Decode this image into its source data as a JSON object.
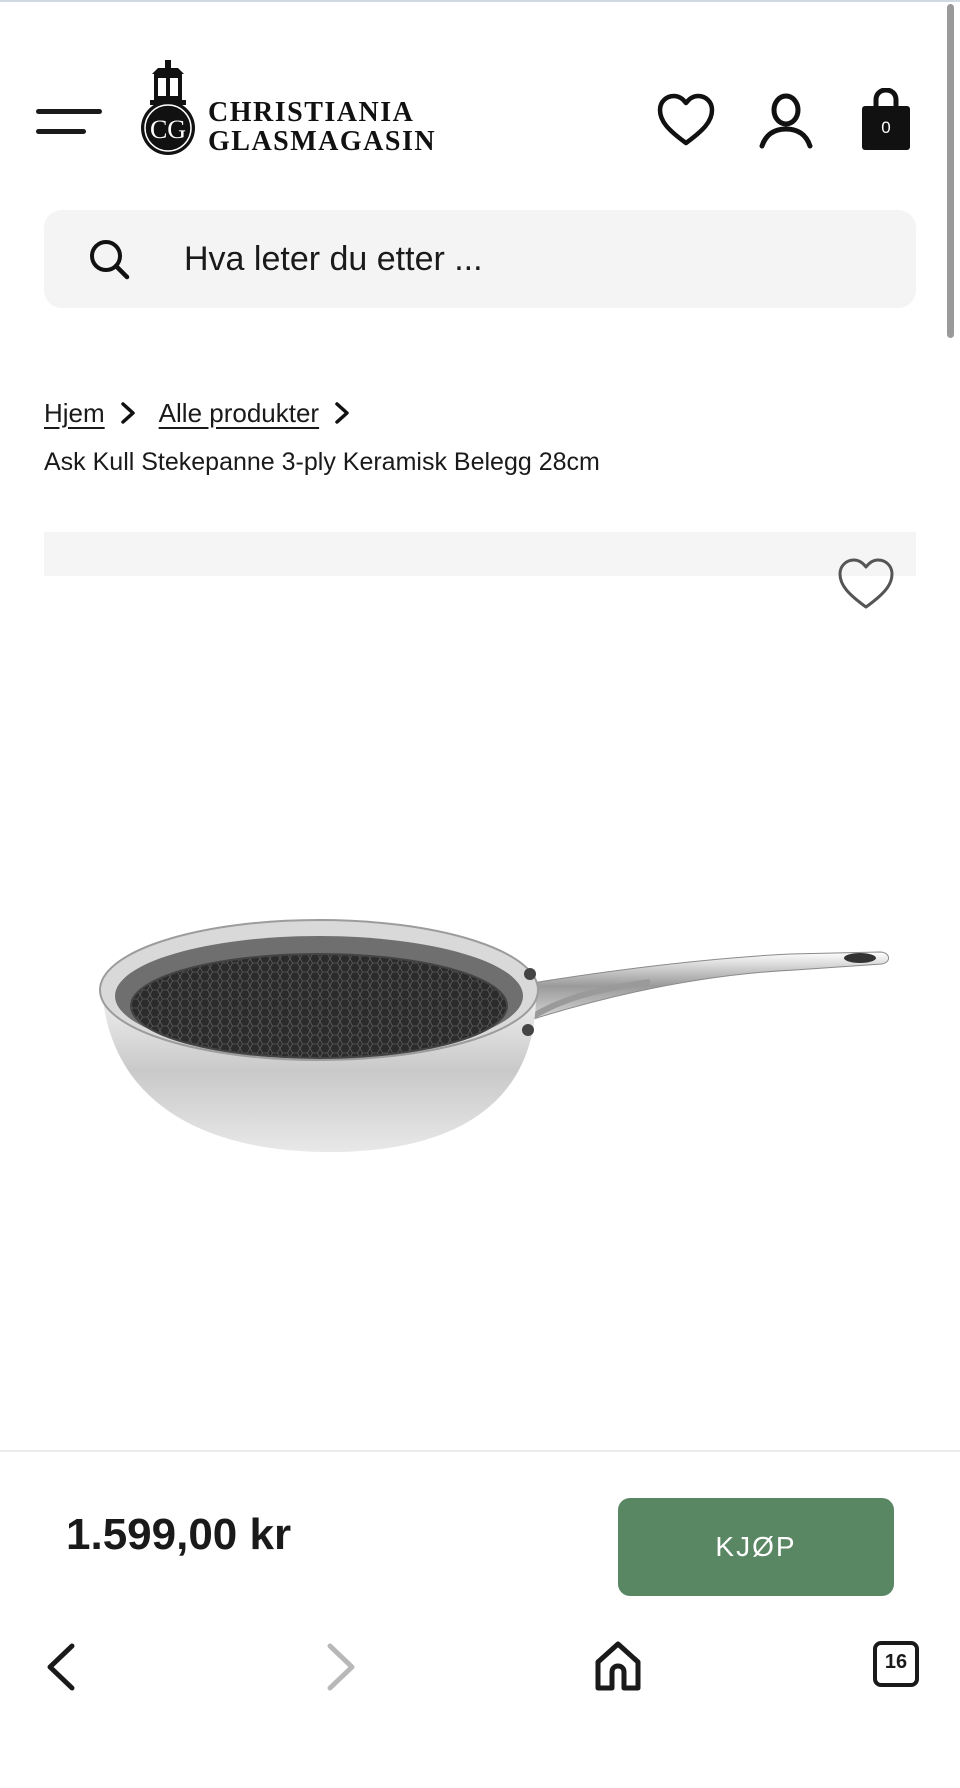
{
  "brand": {
    "name_line1": "CHRISTIANIA",
    "name_line2": "GLASMAGASIN",
    "monogram": "CG"
  },
  "header": {
    "menu_icon": "hamburger-icon",
    "wishlist_icon": "heart-icon",
    "account_icon": "user-icon",
    "cart_icon": "shopping-bag-icon",
    "cart_count": "0"
  },
  "search": {
    "placeholder": "Hva leter du etter ...",
    "icon": "search-icon"
  },
  "breadcrumb": {
    "items": [
      "Hjem",
      "Alle produkter"
    ],
    "current": "Ask Kull Stekepanne 3-ply Keramisk Belegg 28cm"
  },
  "product": {
    "wishlist_icon": "heart-icon",
    "price": "1.599,00 kr",
    "buy_label": "KJØP"
  },
  "browser_nav": {
    "back_icon": "chevron-left-icon",
    "forward_icon": "chevron-right-icon",
    "home_icon": "home-icon",
    "tabs_icon": "tabs-icon",
    "tabs_count": "16"
  },
  "colors": {
    "buy_button": "#5a8763",
    "search_background": "#f4f4f4",
    "text": "#1a1a1a"
  }
}
